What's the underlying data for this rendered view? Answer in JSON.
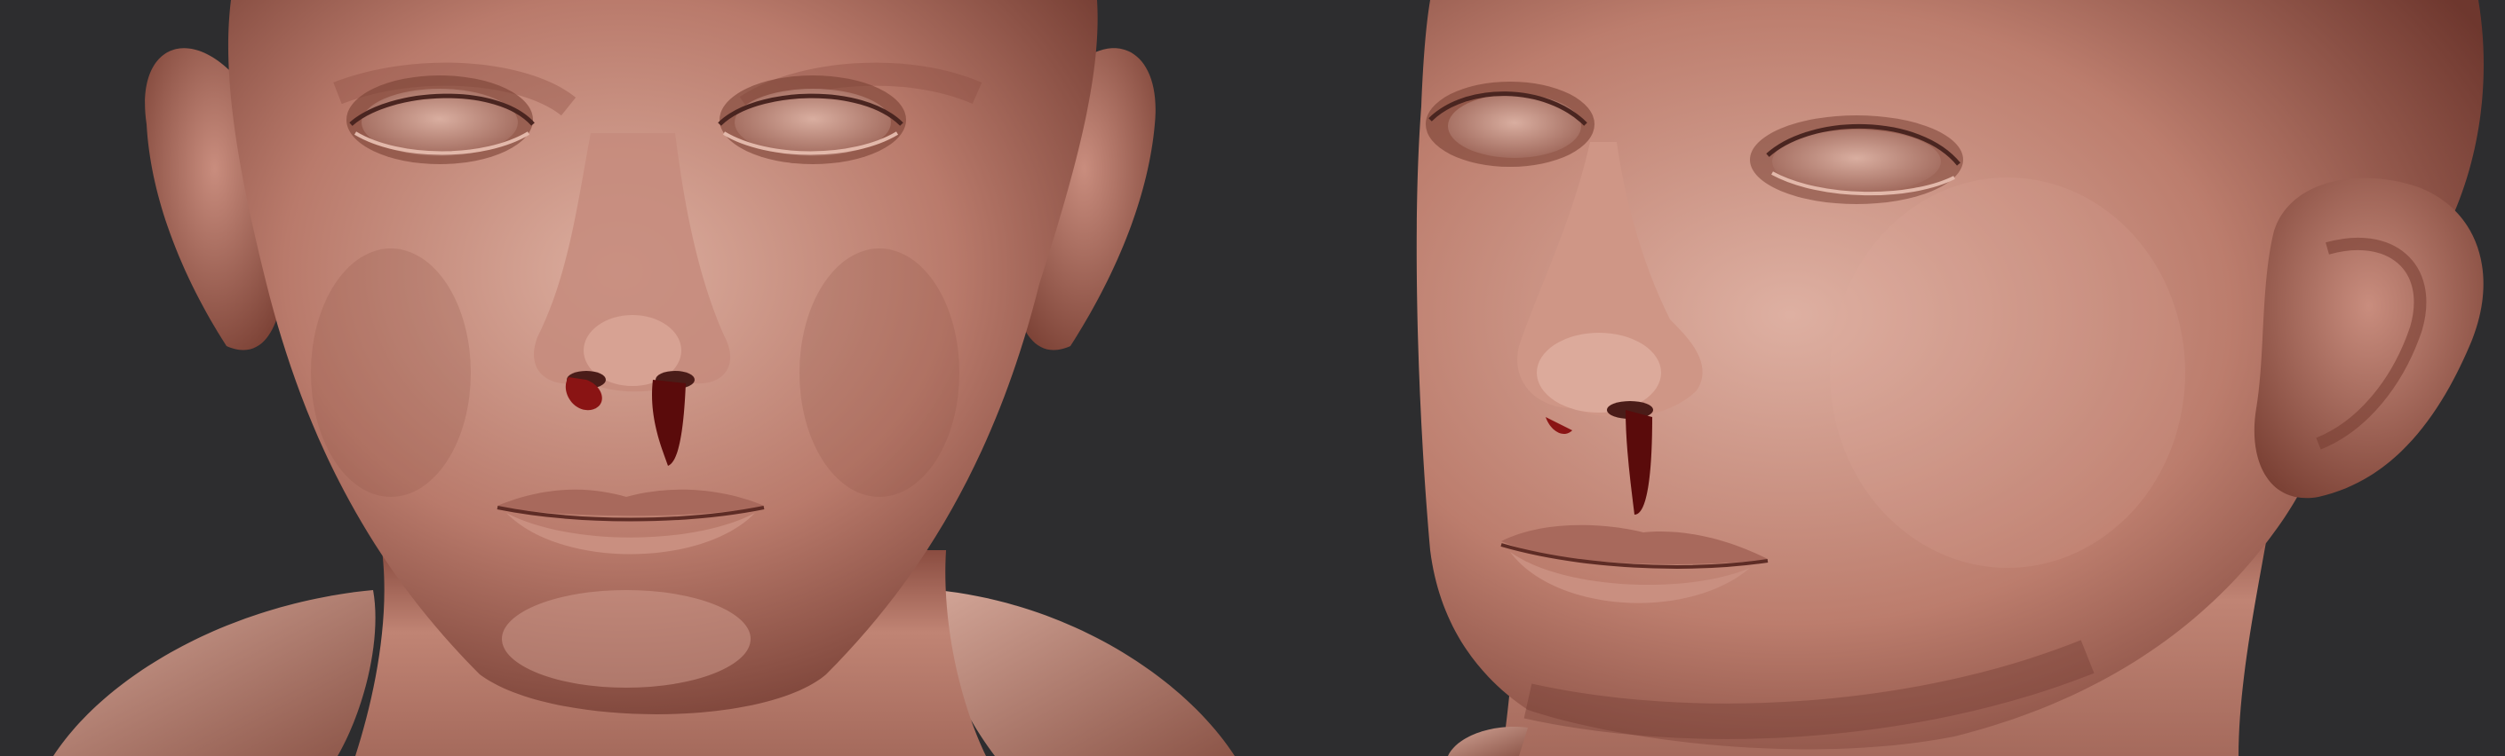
{
  "scene": {
    "views": [
      {
        "name": "front-view"
      },
      {
        "name": "three-quarter-view"
      }
    ]
  },
  "colors": {
    "background": "#2d2d2f",
    "skin_highlight": "#d7a497",
    "skin_mid": "#b8786a",
    "skin_shadow": "#6e3b33",
    "blood": "#5a0b0b",
    "blood_highlight": "#8a1414"
  }
}
